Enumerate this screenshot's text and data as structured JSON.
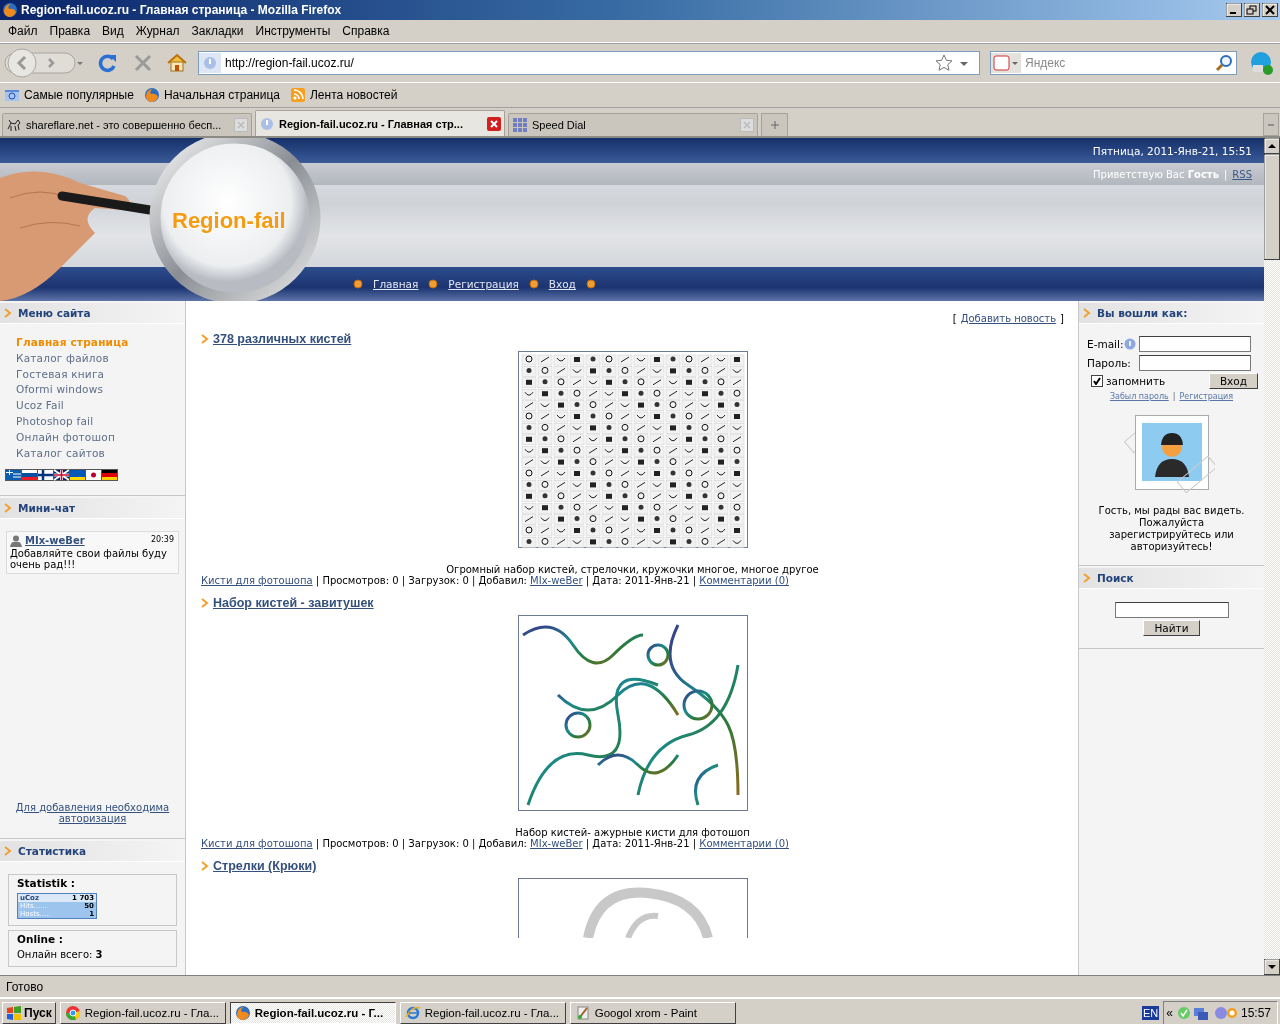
{
  "window": {
    "title": "Region-fail.ucoz.ru - Главная страница - Mozilla Firefox"
  },
  "menu": [
    "Файл",
    "Правка",
    "Вид",
    "Журнал",
    "Закладки",
    "Инструменты",
    "Справка"
  ],
  "address": {
    "value": "http://region-fail.ucoz.ru/"
  },
  "search": {
    "placeholder": "Яндекс"
  },
  "bookmarks": [
    "Самые популярные",
    "Начальная страница",
    "Лента новостей"
  ],
  "tabs": [
    {
      "label": "shareflare.net - это совершенно бесп...",
      "selected": false
    },
    {
      "label": "Region-fail.ucoz.ru - Главная стр...",
      "selected": true
    },
    {
      "label": "Speed Dial",
      "selected": false
    }
  ],
  "site": {
    "logo": "Region-fail",
    "datetime": "Пятница, 2011-Янв-21, 15:51",
    "greeting": "Приветствую Вас **Гость**",
    "separator": "|",
    "rss": "RSS",
    "nav": [
      "Главная",
      "Регистрация",
      "Вход"
    ]
  },
  "left": {
    "menu_title": "Меню сайта",
    "menu": [
      {
        "label": "Главная страница",
        "selected": true
      },
      {
        "label": "Каталог файлов",
        "selected": false
      },
      {
        "label": "Гостевая книга",
        "selected": false
      },
      {
        "label": "Oformi windows",
        "selected": false
      },
      {
        "label": "Ucoz Fail",
        "selected": false
      },
      {
        "label": "Photoshop fail",
        "selected": false
      },
      {
        "label": "Онлайн фотошоп",
        "selected": false
      },
      {
        "label": "Каталог сайтов",
        "selected": false
      }
    ],
    "chat_title": "Мини-чат",
    "chat": [
      {
        "author": "MIx-weBer",
        "time": "20:39",
        "text": "Добавляйте свои файлы буду очень рад!!!"
      }
    ],
    "chat_note": "Для добавления необходима авторизация",
    "stats_title": "Статистика",
    "statistik": "Statistik :",
    "counter": {
      "label": "uCoz",
      "total": "1 703",
      "hits_label": "Hits......",
      "hits": "50",
      "hosts_label": "Hosts.....",
      "hosts": "1"
    },
    "online_title": "Online :",
    "online": "Онлайн всего: **3**"
  },
  "content": {
    "add_news": {
      "open": "[",
      "label": "Добавить новость",
      "close": "]"
    },
    "posts": [
      {
        "title": "378 различных кистей",
        "kind": "grid",
        "caption": "Огромный набор кистей, стрелочки, кружочки многое, многое другое",
        "meta": [
          {
            "text": "Кисти для фотошопа",
            "link": true
          },
          {
            "text": " | Просмотров: 0 | Загрузок: 0 | Добавил: ",
            "link": false
          },
          {
            "text": "MIx-weBer",
            "link": true
          },
          {
            "text": " | Дата: 2011-Янв-21 | ",
            "link": false
          },
          {
            "text": "Комментарии (0)",
            "link": true
          }
        ]
      },
      {
        "title": "Набор кистей - завитушек",
        "kind": "flourish",
        "caption": "Набор кистей- ажурные кисти для фотошоп",
        "meta": [
          {
            "text": "Кисти для фотошопа",
            "link": true
          },
          {
            "text": " | Просмотров: 0 | Загрузок: 0 | Добавил: ",
            "link": false
          },
          {
            "text": "MIx-weBer",
            "link": true
          },
          {
            "text": " | Дата: 2011-Янв-21 | ",
            "link": false
          },
          {
            "text": "Комментарии (0)",
            "link": true
          }
        ]
      },
      {
        "title": "Стрелки (Крюки)",
        "kind": "hook"
      }
    ]
  },
  "right": {
    "login_title": "Вы вошли как:",
    "email_label": "E-mail:",
    "password_label": "Пароль:",
    "remember": {
      "label": "запомнить",
      "checked": true
    },
    "login_button": "Вход",
    "forgot": "Забыл пароль",
    "separator": "|",
    "register": "Регистрация",
    "welcome": "Гость, мы рады вас видеть. Пожалуйста зарегистрируйтесь или авторизуйтесь!",
    "search_title": "Поиск",
    "search_button": "Найти"
  },
  "status_bar": "Готово",
  "taskbar": {
    "start": "Пуск",
    "tasks": [
      {
        "label": "Region-fail.ucoz.ru - Гла...",
        "kind": "wheel",
        "selected": false
      },
      {
        "label": "Region-fail.ucoz.ru - Г...",
        "kind": "fox",
        "selected": true
      },
      {
        "label": "Region-fail.ucoz.ru - Гла...",
        "kind": "globe",
        "selected": false
      },
      {
        "label": "Googol xrom - Paint",
        "kind": "brush",
        "selected": false
      }
    ],
    "lang": "EN",
    "chevron": "«",
    "clock": "15:57"
  }
}
